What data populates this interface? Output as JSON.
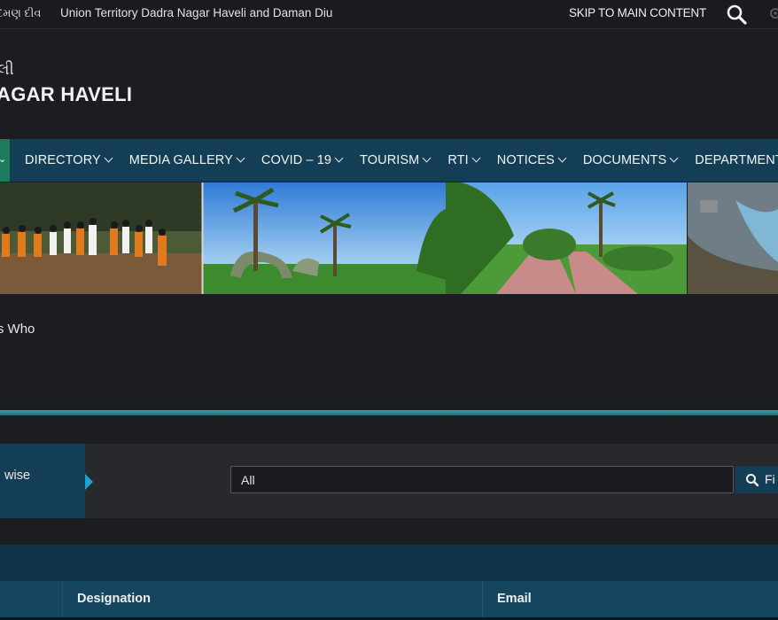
{
  "topbar": {
    "language_link": "દમણ દીવ",
    "territory_name": "Union Territory Dadra Nagar Haveli and Daman Diu",
    "skip_link": "SKIP TO MAIN CONTENT",
    "search_icon": "search-icon",
    "settings_icon": "gear-icon"
  },
  "brand": {
    "line1": "લી",
    "line2": "AGAR HAVELI"
  },
  "nav": {
    "active_color": "#1d7c5c",
    "items": [
      {
        "label": "DIRECTORY"
      },
      {
        "label": "MEDIA GALLERY"
      },
      {
        "label": "COVID – 19"
      },
      {
        "label": "TOURISM"
      },
      {
        "label": "RTI"
      },
      {
        "label": "NOTICES"
      },
      {
        "label": "DOCUMENTS"
      },
      {
        "label": "DEPARTMENT"
      }
    ]
  },
  "breadcrumb": {
    "current": "'s Who"
  },
  "filter": {
    "label": "wise",
    "select_value": "All",
    "button_label": "Fi",
    "button_icon": "search-icon",
    "accent": "#1ba3d4"
  },
  "table": {
    "columns": [
      "Designation",
      "Email"
    ]
  },
  "colors": {
    "background": "#1c1d20",
    "nav_bg": "#143e55",
    "divider": "#3e9aa3"
  }
}
